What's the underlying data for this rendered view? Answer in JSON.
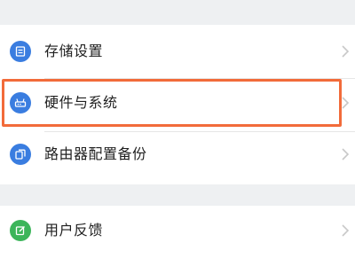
{
  "settings_group_1": {
    "items": [
      {
        "label": "存储设置",
        "icon": "storage-icon",
        "color": "#3a7de0"
      },
      {
        "label": "硬件与系统",
        "icon": "router-hardware-icon",
        "color": "#3a7de0"
      },
      {
        "label": "路由器配置备份",
        "icon": "backup-copy-icon",
        "color": "#3a7de0"
      }
    ]
  },
  "settings_group_2": {
    "items": [
      {
        "label": "用户反馈",
        "icon": "feedback-edit-icon",
        "color": "#3cb55a"
      }
    ]
  },
  "highlight": {
    "target": "硬件与系统",
    "color": "#f26b3a"
  }
}
